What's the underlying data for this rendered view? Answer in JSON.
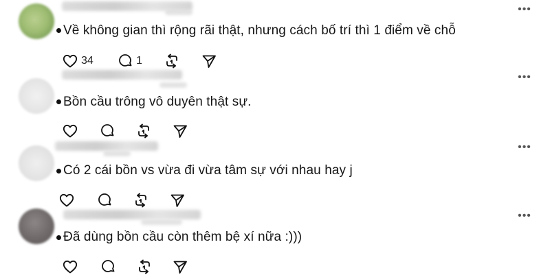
{
  "comments": [
    {
      "text": "Về không gian thì rộng rãi thật, nhưng cách bố trí thì 1 điểm về chỗ",
      "likes": "34",
      "replies": "1"
    },
    {
      "text": "Bồn cầu trông vô duyên thật sự.",
      "likes": "",
      "replies": ""
    },
    {
      "text": "Có 2 cái bồn vs vừa đi vừa tâm sự với nhau hay j",
      "likes": "",
      "replies": ""
    },
    {
      "text": "Đã dùng bồn cầu còn thêm bệ xí nữa :)))",
      "likes": "",
      "replies": ""
    }
  ],
  "more_label": "•••",
  "icons": {
    "like": "heart-icon",
    "reply": "comment-icon",
    "repost": "repost-icon",
    "share": "send-icon"
  }
}
